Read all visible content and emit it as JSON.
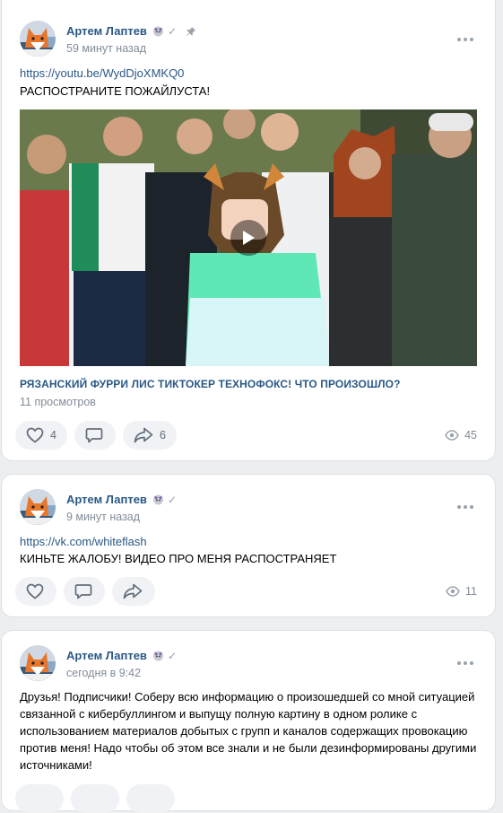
{
  "posts": [
    {
      "author": "Артем Лаптев",
      "time": "59 минут назад",
      "pinned": true,
      "link": "https://youtu.be/WydDjoXMKQ0",
      "text": "РАСПОСТРАНИТЕ ПОЖАЙЛУСТА!",
      "video": {
        "title": "РЯЗАНСКИЙ ФУРРИ ЛИС ТИКТОКЕР ТЕХНОФОКС! ЧТО ПРОИЗОШЛО?",
        "views": "11 просмотров"
      },
      "likes": "4",
      "reposts": "6",
      "views": "45"
    },
    {
      "author": "Артем Лаптев",
      "time": "9 минут назад",
      "link": "https://vk.com/whiteflash",
      "text": "КИНЬТЕ ЖАЛОБУ! ВИДЕО ПРО МЕНЯ РАСПОСТРАНЯЕТ",
      "views": "11"
    },
    {
      "author": "Артем Лаптев",
      "time": "сегодня в 9:42",
      "text": "Друзья! Подписчики! Соберу всю информацию о произошедшей со мной ситуацией связанной с кибербуллингом и выпущу полную картину в одном ролике с использованием материалов добытых с групп и каналов содержащих провокацию против меня! Надо чтобы об этом все знали и не были дезинформированы другими источниками!"
    }
  ],
  "colors": {
    "link": "#2a5885",
    "secondary": "#818c99",
    "pill_bg": "#f0f2f5",
    "page_bg": "#edeef0"
  },
  "icons": [
    "heart-icon",
    "comment-icon",
    "share-icon",
    "eye-icon",
    "more-icon",
    "pin-icon",
    "verified-check-icon"
  ]
}
